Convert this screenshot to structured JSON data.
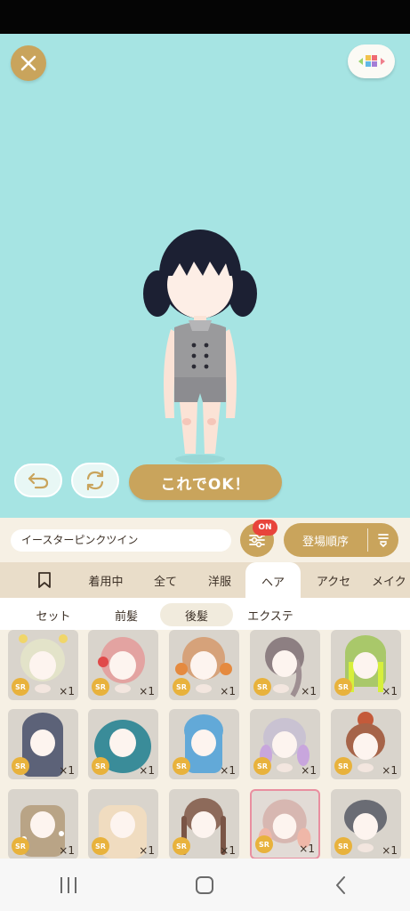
{
  "header": {
    "close_icon": "close-icon",
    "palette_icon": "color-palette-icon"
  },
  "stage": {
    "ok_button": "これでOK！",
    "undo_icon": "undo-icon",
    "rotate_icon": "rotate-icon"
  },
  "toolbar": {
    "item_name": "イースターピンクツイン",
    "filter_badge": "ON",
    "sort_label": "登場順序"
  },
  "tabs": [
    {
      "label": "",
      "icon": "bookmark-icon"
    },
    {
      "label": "着用中"
    },
    {
      "label": "全て"
    },
    {
      "label": "洋服"
    },
    {
      "label": "ヘア",
      "active": true
    },
    {
      "label": "アクセ"
    },
    {
      "label": "メイク"
    }
  ],
  "subtabs": [
    {
      "label": "セット"
    },
    {
      "label": "前髪"
    },
    {
      "label": "後髪",
      "active": true
    },
    {
      "label": "エクステ"
    }
  ],
  "items": [
    {
      "rarity": "SR",
      "count": "×1",
      "hair": "#e3e3c9"
    },
    {
      "rarity": "SR",
      "count": "×1",
      "hair": "#e3a3a1"
    },
    {
      "rarity": "SR",
      "count": "×1",
      "hair": "#d6a27a"
    },
    {
      "rarity": "SR",
      "count": "×1",
      "hair": "#8d7f82"
    },
    {
      "rarity": "SR",
      "count": "×1",
      "hair": "#a9c86a"
    },
    {
      "rarity": "SR",
      "count": "×1",
      "hair": "#5c6278"
    },
    {
      "rarity": "SR",
      "count": "×1",
      "hair": "#3a8c99"
    },
    {
      "rarity": "SR",
      "count": "×1",
      "hair": "#62a9d8"
    },
    {
      "rarity": "SR",
      "count": "×1",
      "hair": "#c9c2d2"
    },
    {
      "rarity": "SR",
      "count": "×1",
      "hair": "#a66449"
    },
    {
      "rarity": "SR",
      "count": "×1",
      "hair": "#b9a486"
    },
    {
      "rarity": "SR",
      "count": "×1",
      "hair": "#f0dcc0"
    },
    {
      "rarity": "SR",
      "count": "×1",
      "hair": "#8d6a5a"
    },
    {
      "rarity": "SR",
      "count": "×1",
      "hair": "#d7b7b1",
      "selected": true
    },
    {
      "rarity": "SR",
      "count": "×1",
      "hair": "#6a6c74"
    }
  ],
  "navbar": {
    "recents": "recent-apps-icon",
    "home": "home-icon",
    "back": "back-icon"
  },
  "colors": {
    "accent": "#c9a45c",
    "stage_bg": "#a6e4e3",
    "panel_bg": "#f6f0e4",
    "tab_bg": "#e9ddc9",
    "badge_red": "#e8443b",
    "rarity_gold": "#e8b23c"
  }
}
